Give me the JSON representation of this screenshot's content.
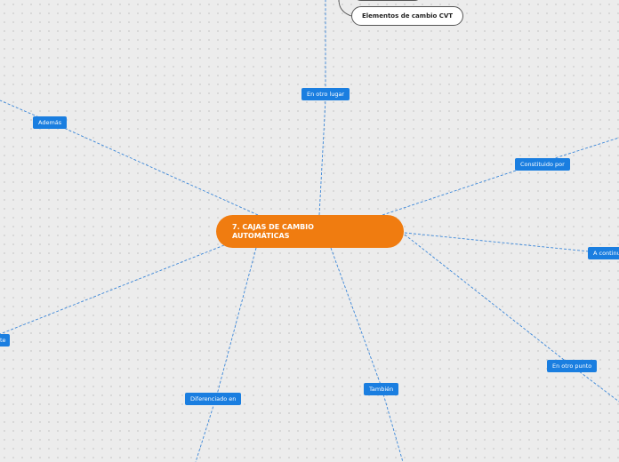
{
  "central": {
    "title_line1": "7. CAJAS DE CAMBIO",
    "title_line2": "AUTOMÁTICAS"
  },
  "links": {
    "en_otro_lugar": "En otro lugar",
    "ademas": "Además",
    "constituido_por": "Constituido por",
    "a_continuacion": "A continu",
    "left_cut": "te",
    "diferenciado_en": "Diferenciado en",
    "tambien": "También",
    "en_otro_punto": "En otro punto"
  },
  "topics": {
    "cvt": "Elementos de cambio CVT"
  },
  "colors": {
    "central": "#f07c10",
    "link_label": "#1a7ee0",
    "connector": "#3a86d8",
    "background": "#ececec"
  }
}
